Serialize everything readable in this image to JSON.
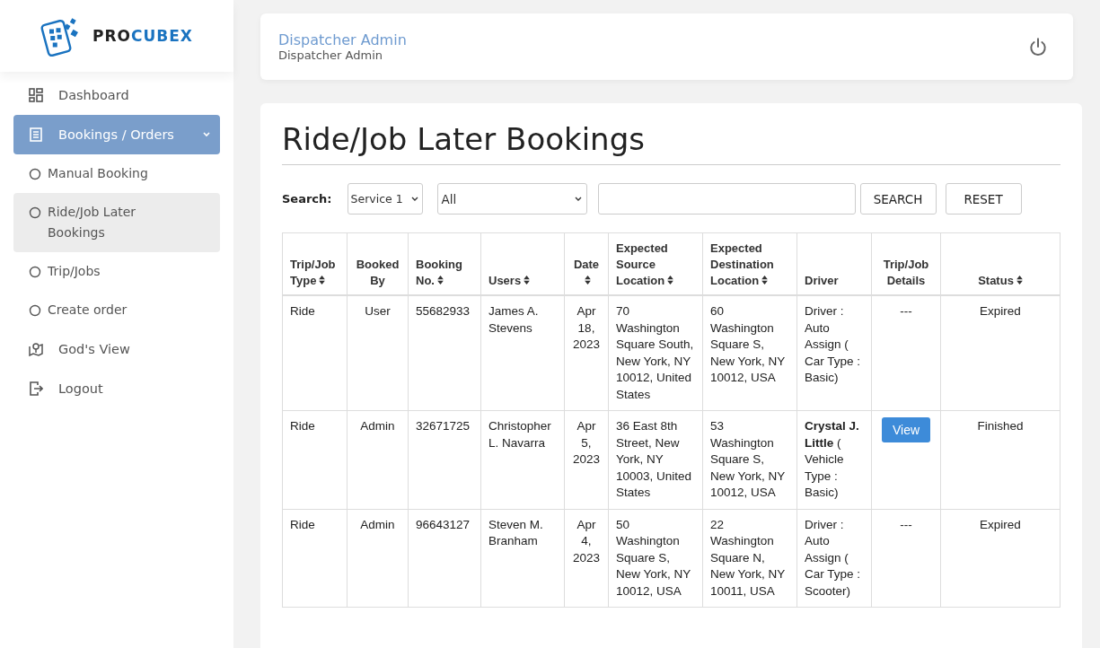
{
  "logo": {
    "text_dark": "PRO",
    "text_blue": "CUBEX"
  },
  "sidebar": {
    "items": [
      {
        "label": "Dashboard",
        "selected": false
      },
      {
        "label": "Bookings / Orders",
        "selected": true,
        "expanded": true,
        "children": [
          {
            "label": "Manual Booking",
            "selected": false
          },
          {
            "label": "Ride/Job Later Bookings",
            "selected": true
          },
          {
            "label": "Trip/Jobs",
            "selected": false
          },
          {
            "label": "Create order",
            "selected": false
          }
        ]
      },
      {
        "label": "God's View",
        "selected": false
      },
      {
        "label": "Logout",
        "selected": false
      }
    ]
  },
  "header": {
    "name": "Dispatcher Admin",
    "role": "Dispatcher Admin"
  },
  "page": {
    "title": "Ride/Job Later Bookings"
  },
  "search": {
    "label": "Search:",
    "service_select": "Service 1",
    "filter_select": "All",
    "buttons": [
      "SEARCH",
      "RESET"
    ]
  },
  "table": {
    "columns": [
      {
        "label": "Trip/Job Type",
        "sortable": true
      },
      {
        "label": "Booked By",
        "sortable": false
      },
      {
        "label": "Booking No.",
        "sortable": true
      },
      {
        "label": "Users",
        "sortable": true
      },
      {
        "label": "Date",
        "sortable": true
      },
      {
        "label": "Expected Source Location",
        "sortable": true
      },
      {
        "label": "Expected Destination Location",
        "sortable": true
      },
      {
        "label": "Driver",
        "sortable": false
      },
      {
        "label": "Trip/Job Details",
        "sortable": false
      },
      {
        "label": "Status",
        "sortable": true
      }
    ],
    "rows": [
      {
        "type": "Ride",
        "booked_by": "User",
        "booking_no": "55682933",
        "user": "James A. Stevens",
        "date": "Apr 18, 2023",
        "source": "70 Washington Square South, New York, NY 10012, United States",
        "destination": "60 Washington Square S, New York, NY 10012, USA",
        "driver": "Driver : Auto Assign ( Car Type : Basic)",
        "details": {
          "kind": "text",
          "text": "---"
        },
        "status": "Expired"
      },
      {
        "type": "Ride",
        "booked_by": "Admin",
        "booking_no": "32671725",
        "user": "Christopher L. Navarra",
        "date": "Apr 5, 2023",
        "source": "36 East 8th Street, New York, NY 10003, United States",
        "destination": "53 Washington Square S, New York, NY 10012, USA",
        "driver": "**Crystal J. Little** ( Vehicle Type : Basic)",
        "details": {
          "kind": "button",
          "text": "View"
        },
        "status": "Finished"
      },
      {
        "type": "Ride",
        "booked_by": "Admin",
        "booking_no": "96643127",
        "user": "Steven M. Branham",
        "date": "Apr 4, 2023",
        "source": "50 Washington Square S, New York, NY 10012, USA",
        "destination": "22 Washington Square N, New York, NY 10011, USA",
        "driver": "Driver : Auto Assign ( Car Type : Scooter)",
        "details": {
          "kind": "text",
          "text": "---"
        },
        "status": "Expired"
      }
    ]
  }
}
